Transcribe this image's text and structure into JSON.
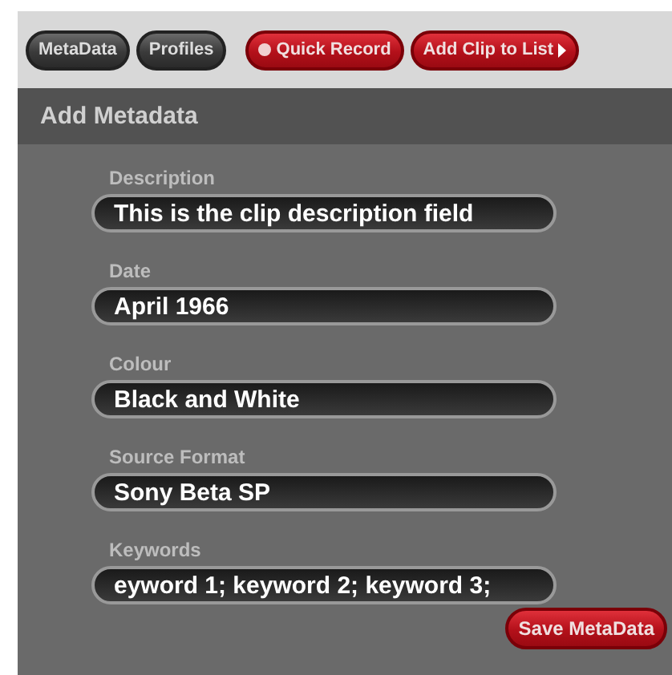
{
  "toolbar": [
    {
      "label": "MetaData",
      "kind": "tab"
    },
    {
      "label": "Profiles",
      "kind": "tab"
    },
    {
      "label": "Quick Record",
      "kind": "record"
    },
    {
      "label": "Add Clip to List",
      "kind": "add"
    }
  ],
  "panel": {
    "title": "Add Metadata",
    "fields": [
      {
        "label": "Description",
        "value": "This is the clip description field"
      },
      {
        "label": "Date",
        "value": "April 1966"
      },
      {
        "label": "Colour",
        "value": "Black and White"
      },
      {
        "label": "Source Format",
        "value": "Sony Beta SP"
      },
      {
        "label": "Keywords",
        "value": "eyword 1; keyword 2; keyword 3;"
      }
    ],
    "save_button": "Save MetaData"
  }
}
